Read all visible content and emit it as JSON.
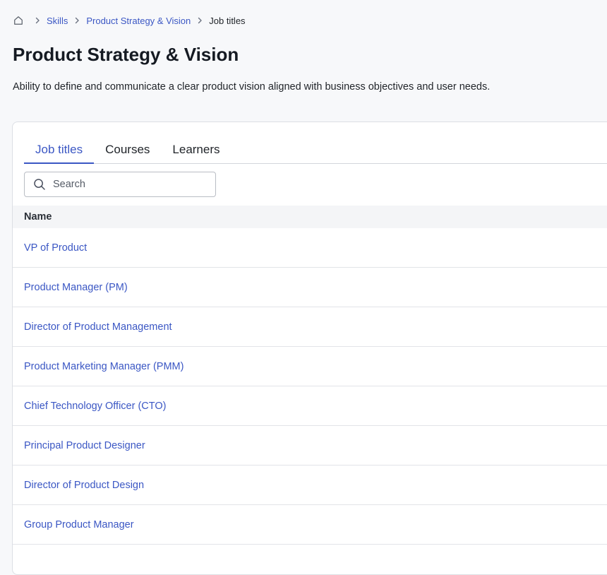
{
  "breadcrumb": {
    "home_icon": "home-icon",
    "separator_icon": "chevron-right-icon",
    "items": [
      {
        "label": "Skills"
      },
      {
        "label": "Product Strategy & Vision"
      },
      {
        "label": "Job titles"
      }
    ]
  },
  "page": {
    "title": "Product Strategy & Vision",
    "description": "Ability to define and communicate a clear product vision aligned with business objectives and user needs."
  },
  "tabs": [
    {
      "label": "Job titles",
      "active": true
    },
    {
      "label": "Courses",
      "active": false
    },
    {
      "label": "Learners",
      "active": false
    }
  ],
  "search": {
    "placeholder": "Search",
    "value": "",
    "icon": "search-icon"
  },
  "table": {
    "columns": [
      "Name"
    ],
    "rows": [
      "VP of Product",
      "Product Manager (PM)",
      "Director of Product Management",
      "Product Marketing Manager (PMM)",
      "Chief Technology Officer (CTO)",
      "Principal Product Designer",
      "Director of Product Design",
      "Group Product Manager"
    ]
  },
  "colors": {
    "accent": "#3b57c4",
    "text": "#1f2328",
    "background": "#f7f8fa",
    "card": "#ffffff",
    "border": "#dcdfe4"
  }
}
